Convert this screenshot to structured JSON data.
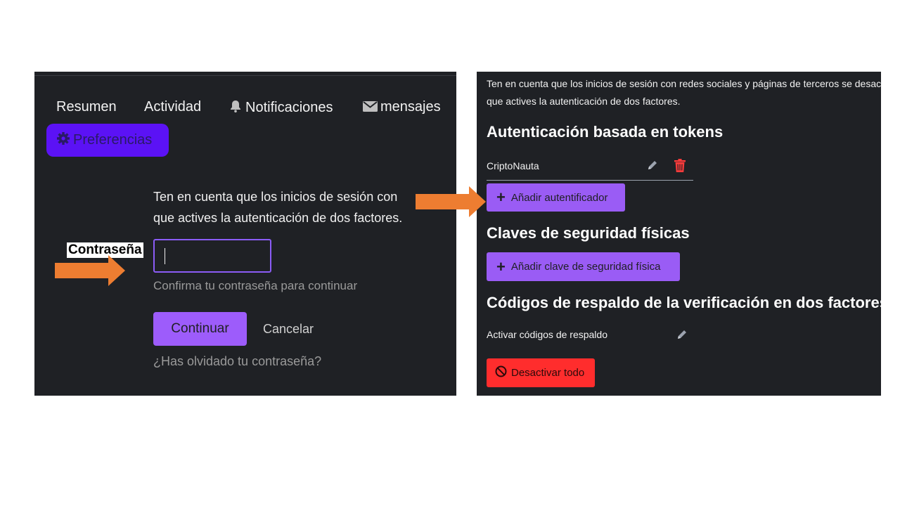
{
  "left": {
    "nav": {
      "resumen": "Resumen",
      "actividad": "Actividad",
      "notificaciones": "Notificaciones",
      "mensajes": "mensajes",
      "preferencias": "Preferencias"
    },
    "notice_line1": "Ten en cuenta que los inicios de sesión con",
    "notice_line2": "que actives la autenticación de dos factores.",
    "password_hint": "Confirma tu contraseña para continuar",
    "continue_label": "Continuar",
    "cancel_label": "Cancelar",
    "forgot_label": "¿Has olvidado tu contraseña?"
  },
  "right": {
    "notice_line1": "Ten en cuenta que los inicios de sesión con redes sociales y páginas de terceros se desac",
    "notice_line2": "que actives la autenticación de dos factores.",
    "tokens_heading": "Autenticación basada en tokens",
    "token_name": "CriptoNauta",
    "add_authenticator": "Añadir autentificador",
    "physical_heading": "Claves de seguridad físicas",
    "add_physical_key": "Añadir clave de seguridad física",
    "backup_heading": "Códigos de respaldo de la verificación en dos factores",
    "activate_backup": "Activar códigos de respaldo",
    "deactivate_all": "Desactivar todo"
  },
  "annotation": {
    "password_label": "Contraseña"
  },
  "colors": {
    "panel_bg": "#1f2125",
    "accent_purple": "#9a5cf5",
    "preferences_pill": "#5b12f5",
    "danger_red": "#ff2d2d",
    "arrow_orange": "#ed7d31"
  },
  "icons": {
    "bell": "bell-icon",
    "mail": "mail-icon",
    "gear": "gear-icon",
    "pencil": "pencil-icon",
    "trash": "trash-icon",
    "plus": "plus-icon",
    "ban": "ban-icon"
  }
}
